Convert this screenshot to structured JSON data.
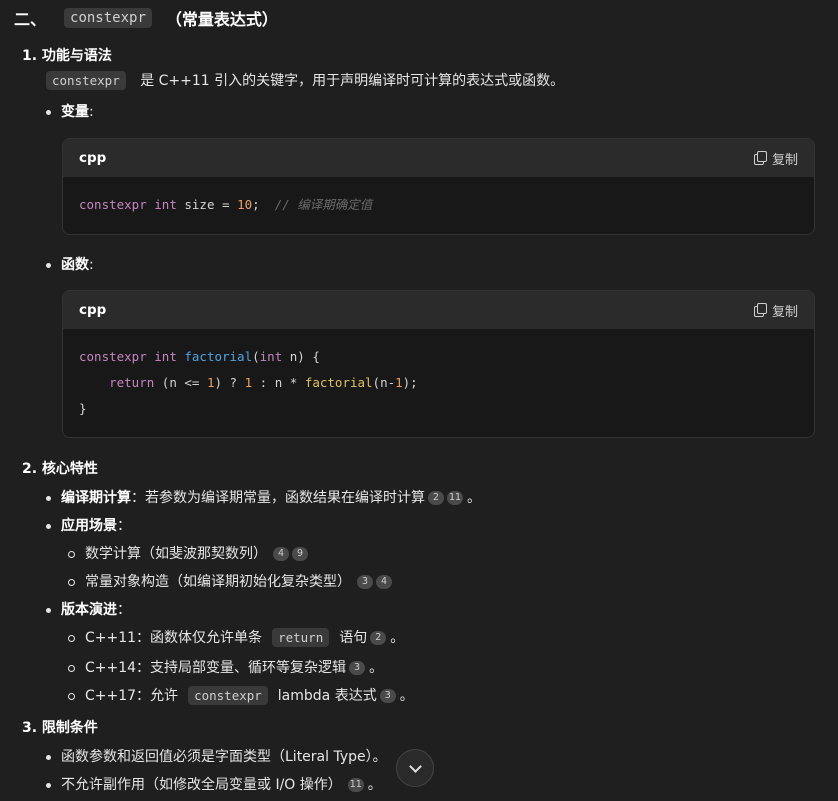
{
  "heading": {
    "prefix": "二、",
    "code": "constexpr",
    "suffix": "（常量表达式）"
  },
  "s1": {
    "title": "1. 功能与语法",
    "intro_code": "constexpr",
    "intro_text": "是 C++11 引入的关键字，用于声明编译时可计算的表达式或函数。",
    "var_label": "变量",
    "func_label": "函数",
    "colon": ":"
  },
  "code1": {
    "lang": "cpp",
    "copy": "复制",
    "t": [
      "constexpr",
      " ",
      "int",
      " size = ",
      "10",
      ";  ",
      "// 编译期确定值"
    ]
  },
  "code2": {
    "lang": "cpp",
    "copy": "复制",
    "l1": [
      "constexpr",
      " ",
      "int",
      " ",
      "factorial",
      "(",
      "int",
      " n) {"
    ],
    "l2": [
      "    ",
      "return",
      " (n <= ",
      "1",
      ") ? ",
      "1",
      " : n * ",
      "factorial",
      "(n-",
      "1",
      ");"
    ],
    "l3": "}"
  },
  "s2": {
    "title": "2. 核心特性",
    "i1_label": "编译期计算",
    "i1_text": "：若参数为编译期常量，函数结果在编译时计算",
    "i1_cites": [
      "2",
      "11"
    ],
    "period": "。",
    "i2_label": "应用场景",
    "i2_colon": "：",
    "i2a": "数学计算（如斐波那契数列）",
    "i2a_cites": [
      "4",
      "9"
    ],
    "i2b": "常量对象构造（如编译期初始化复杂类型）",
    "i2b_cites": [
      "3",
      "4"
    ],
    "i3_label": "版本演进",
    "i3_colon": "：",
    "i3a_pre": "C++11：函数体仅允许单条",
    "i3a_code": "return",
    "i3a_post": "语句",
    "i3a_cite": "2",
    "i3b": "C++14：支持局部变量、循环等复杂逻辑",
    "i3b_cite": "3",
    "i3c_pre": "C++17：允许",
    "i3c_code": "constexpr",
    "i3c_post": "lambda 表达式",
    "i3c_cite": "3"
  },
  "s3": {
    "title": "3. 限制条件",
    "i1": "函数参数和返回值必须是字面类型（Literal Type）",
    "i2": "不允许副作用（如修改全局变量或 I/O 操作）",
    "i2_cite": "11",
    "period": "。"
  },
  "icons": {
    "copy": "copy-icon",
    "scroll": "chevron-down-icon"
  }
}
